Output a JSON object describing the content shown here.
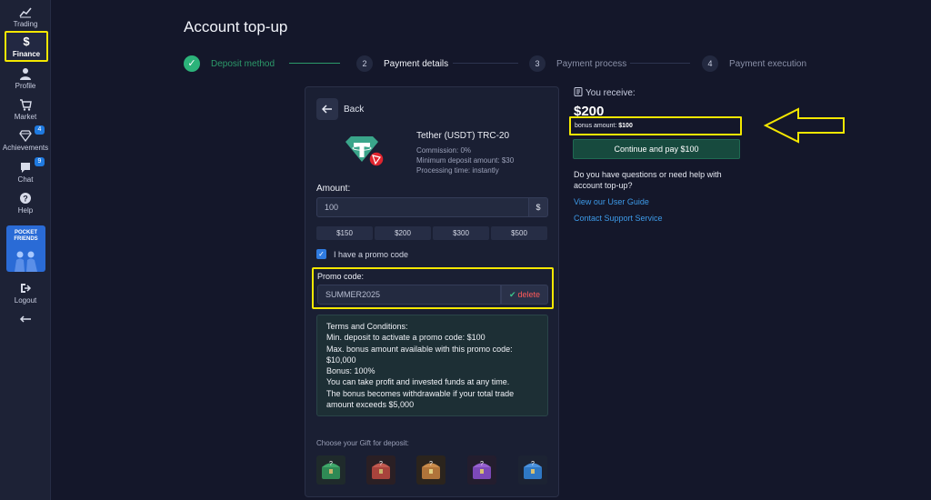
{
  "sidebar": {
    "items": [
      {
        "label": "Trading",
        "icon": "chart-line-icon"
      },
      {
        "label": "Finance",
        "icon": "dollar-icon"
      },
      {
        "label": "Profile",
        "icon": "user-icon"
      },
      {
        "label": "Market",
        "icon": "cart-icon"
      },
      {
        "label": "Achievements",
        "icon": "diamond-icon",
        "badge": "4"
      },
      {
        "label": "Chat",
        "icon": "chat-icon",
        "badge": "9"
      },
      {
        "label": "Help",
        "icon": "help-icon"
      },
      {
        "label": "Logout",
        "icon": "logout-icon"
      }
    ],
    "promo_card": "POCKET FRIENDS",
    "collapse_icon": "arrow-left-icon"
  },
  "page": {
    "title": "Account top-up"
  },
  "stepper": {
    "steps": [
      {
        "number": "1",
        "label": "Deposit method",
        "state": "done"
      },
      {
        "number": "2",
        "label": "Payment details",
        "state": "active"
      },
      {
        "number": "3",
        "label": "Payment process",
        "state": "pending"
      },
      {
        "number": "4",
        "label": "Payment execution",
        "state": "pending"
      }
    ]
  },
  "card": {
    "back_label": "Back",
    "coin_name": "Tether (USDT) TRC-20",
    "commission": "Commission: 0%",
    "min_deposit": "Minimum deposit amount: $30",
    "processing_time": "Processing time: instantly",
    "amount_label": "Amount:",
    "amount_value": "100",
    "currency": "$",
    "presets": [
      "$150",
      "$200",
      "$300",
      "$500"
    ],
    "promo_checkbox_label": "I have a promo code",
    "promo_checked": true,
    "promo_label": "Promo code:",
    "promo_value": "SUMMER2025",
    "promo_delete": "delete",
    "terms": [
      "Terms and Conditions:",
      "Min. deposit to activate a promo code: $100",
      "Max. bonus amount available with this promo code: $10,000",
      "Bonus: 100%",
      "You can take profit and invested funds at any time.",
      "The bonus becomes withdrawable if your total trade amount exceeds $5,000"
    ],
    "gift_label": "Choose your Gift for deposit:",
    "gift_colors": [
      "#2f8a55",
      "#a8433c",
      "#b0743a",
      "#7c49b8",
      "#2f78c4"
    ]
  },
  "summary": {
    "receive_label": "You receive:",
    "receive_amount": "$200",
    "bonus_label": "bonus amount:",
    "bonus_value": "$100",
    "pay_button": "Continue and pay $100",
    "help_question": "Do you have questions or need help with account top-up?",
    "links": [
      "View our User Guide",
      "Contact Support Service"
    ]
  },
  "colors": {
    "accent": "#2f7be0",
    "success": "#2cb37a",
    "highlight": "#f4e700",
    "danger": "#ff5a5a"
  }
}
